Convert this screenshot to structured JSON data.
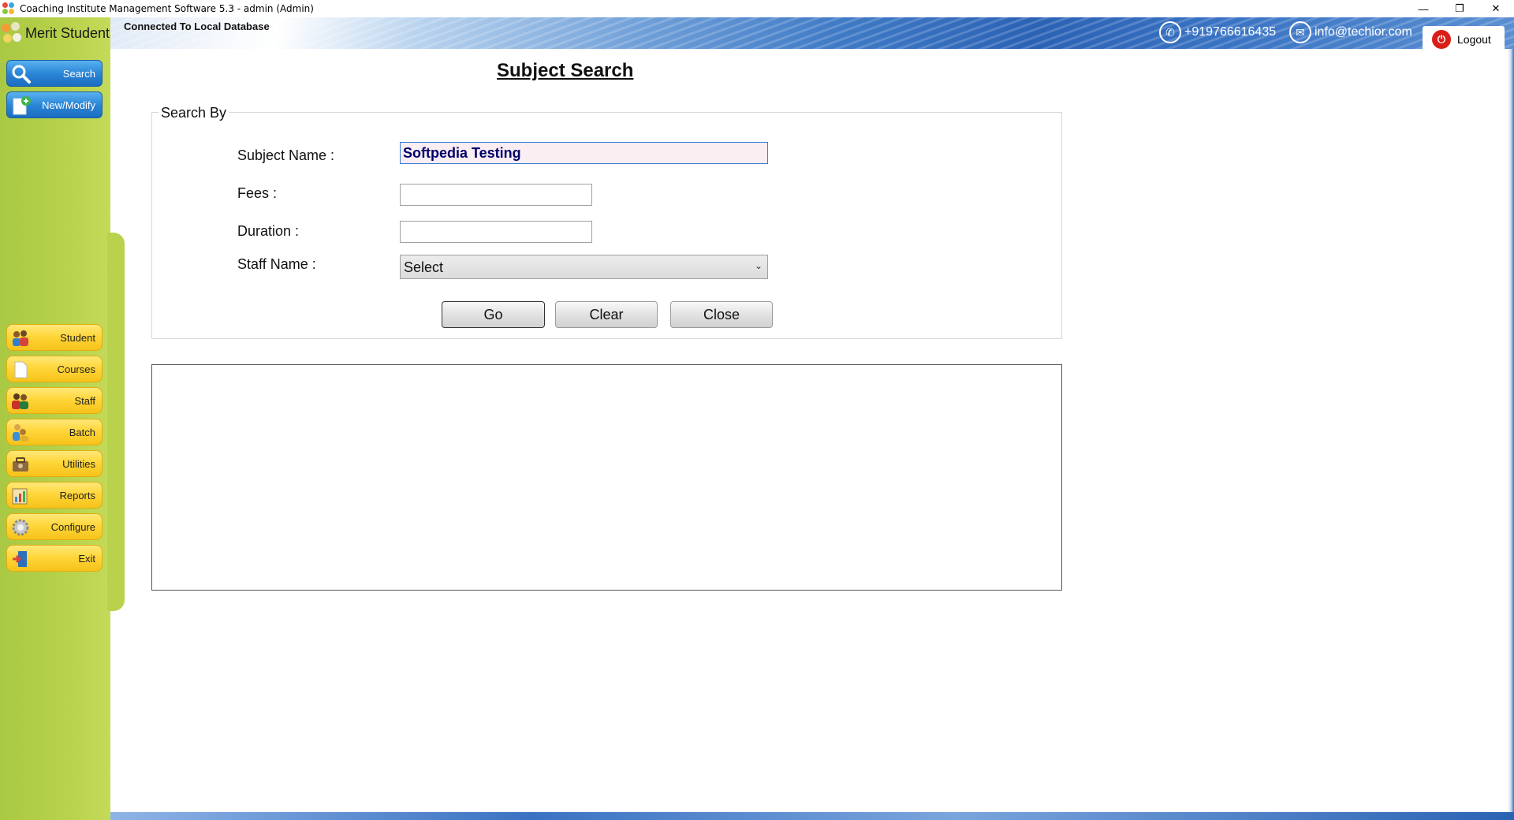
{
  "window": {
    "title": "Coaching Institute Management Software 5.3  -  admin (Admin)",
    "controls": {
      "minimize": "—",
      "restore": "❐",
      "close": "✕"
    }
  },
  "brand": {
    "name": "Merit Students"
  },
  "header": {
    "connection": "Connected To  Local Database",
    "phone": "+919766616435",
    "email": "info@techior.com",
    "logout": "Logout"
  },
  "sidebar": {
    "top_buttons": [
      {
        "label": "Search",
        "icon": "magnifier-icon"
      },
      {
        "label": "New/Modify",
        "icon": "new-document-icon"
      }
    ],
    "menu": [
      {
        "label": "Student",
        "icon": "students-icon"
      },
      {
        "label": "Courses",
        "icon": "document-icon"
      },
      {
        "label": "Staff",
        "icon": "staff-icon"
      },
      {
        "label": "Batch",
        "icon": "batch-icon"
      },
      {
        "label": "Utilities",
        "icon": "toolbox-icon"
      },
      {
        "label": "Reports",
        "icon": "reports-icon"
      },
      {
        "label": "Configure",
        "icon": "gear-icon"
      },
      {
        "label": "Exit",
        "icon": "exit-door-icon"
      }
    ]
  },
  "page": {
    "title": "Subject Search",
    "group_label": "Search By",
    "fields": {
      "subject_name": {
        "label": "Subject Name :",
        "value": "Softpedia Testing"
      },
      "fees": {
        "label": "Fees :",
        "value": ""
      },
      "duration": {
        "label": "Duration :",
        "value": ""
      },
      "staff_name": {
        "label": "Staff Name :",
        "selected": "Select"
      }
    },
    "buttons": {
      "go": "Go",
      "clear": "Clear",
      "close": "Close"
    }
  },
  "colors": {
    "sidebar": "#b8d24b",
    "nav_button": "#ffd63a",
    "action_button": "#2a86d7",
    "header": "#2a62b4",
    "logout_icon": "#d91e18",
    "focused_input_bg": "#fbeef3"
  }
}
